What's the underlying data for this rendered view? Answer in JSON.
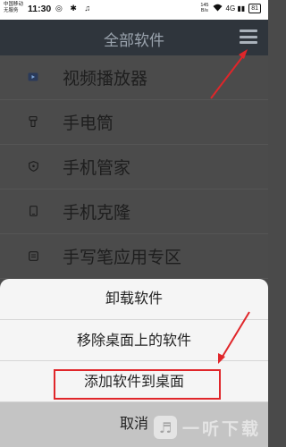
{
  "status_bar": {
    "carrier_line1": "中国移动",
    "carrier_line2": "无服务",
    "time": "11:30",
    "left_icons": "◎ ✱ ♫",
    "net_speed_value": "145",
    "net_speed_unit": "B/s",
    "signal": "4G ▮▮",
    "battery": "81"
  },
  "title_bar": {
    "title": "全部软件",
    "menu_icon": "hamburger-menu-icon"
  },
  "list": {
    "items": [
      {
        "label": "视频播放器",
        "icon": "video-player-icon"
      },
      {
        "label": "手电筒",
        "icon": "flashlight-icon"
      },
      {
        "label": "手机管家",
        "icon": "shield-icon"
      },
      {
        "label": "手机克隆",
        "icon": "phone-clone-icon"
      },
      {
        "label": "手写笔应用专区",
        "icon": "stylus-icon"
      }
    ]
  },
  "sheet": {
    "uninstall": "卸载软件",
    "remove_from_desktop": "移除桌面上的软件",
    "add_to_desktop": "添加软件到桌面",
    "cancel": "取消"
  },
  "annotation_color": "#e0262a",
  "watermark": {
    "text": "一听下载",
    "logo_glyph": "♬"
  }
}
